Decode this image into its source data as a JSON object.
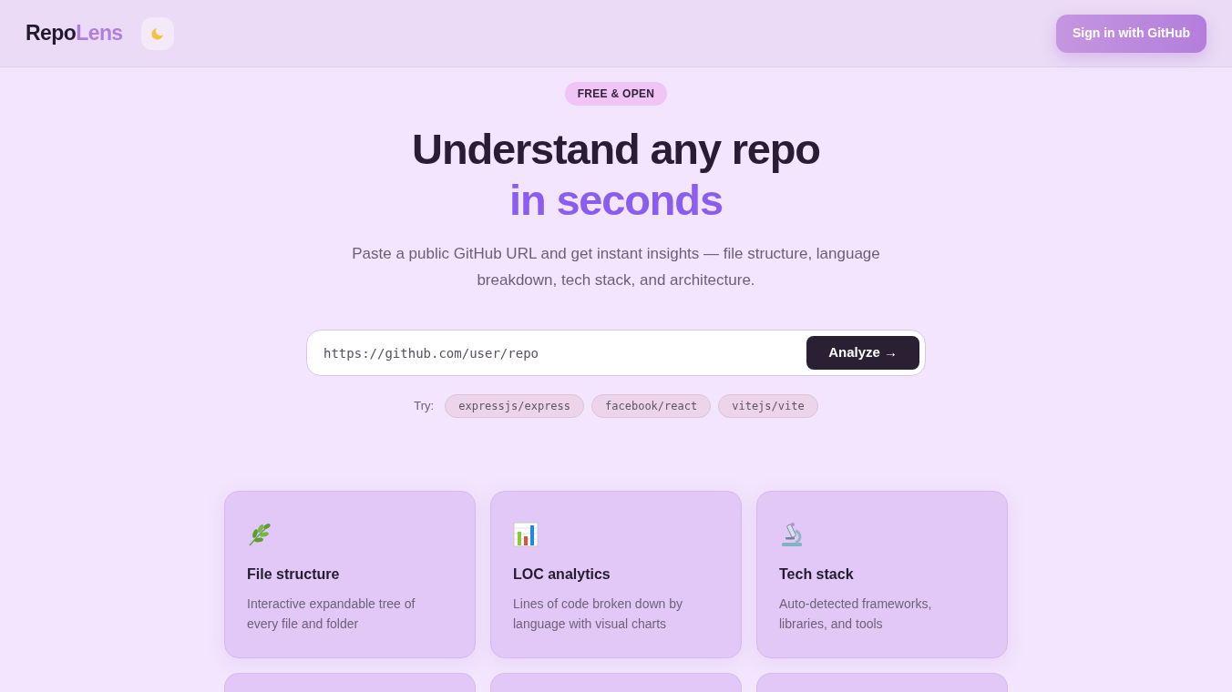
{
  "header": {
    "logo": {
      "text": "Repo",
      "accent": "Lens"
    },
    "sign_in_button": "Sign in with GitHub"
  },
  "hero": {
    "badge": "FREE & OPEN",
    "title": "Understand any repo",
    "title_highlight": "in seconds",
    "description": "Paste a public GitHub URL and get instant insights — file structure, language breakdown, tech stack, and architecture."
  },
  "search": {
    "placeholder": "https://github.com/user/repo",
    "button": "Analyze →"
  },
  "examples": {
    "label": "Try:",
    "items": [
      "expressjs/express",
      "facebook/react",
      "vitejs/vite"
    ]
  },
  "features": [
    {
      "title": "File structure",
      "description": "Interactive expandable tree of every file and folder"
    },
    {
      "title": "LOC analytics",
      "description": "Lines of code broken down by language with visual charts"
    },
    {
      "title": "Tech stack",
      "description": "Auto-detected frameworks, libraries, and tools"
    }
  ]
}
